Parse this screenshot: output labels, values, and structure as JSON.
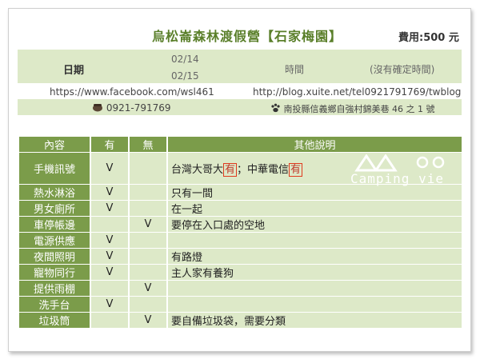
{
  "header": {
    "title": "烏松崙森林渡假營【石家梅園】",
    "fee": "費用:500 元"
  },
  "info": {
    "date_label": "日期",
    "date1": "02/14",
    "date2": "02/15",
    "time_label": "時間",
    "time_value": "(沒有確定時間)",
    "facebook": "https://www.facebook.com/wsl461",
    "blog": "http://blog.xuite.net/tel0921791769/twblog",
    "phone": "0921-791769",
    "address": "南投縣信義鄉自強村錦美巷 46 之 1 號"
  },
  "table": {
    "headers": [
      "內容",
      "有",
      "無",
      "其他說明"
    ],
    "rows": [
      {
        "item": "手機訊號",
        "yes": "V",
        "no": "",
        "note": "",
        "tall": true
      },
      {
        "item": "熱水淋浴",
        "yes": "V",
        "no": "",
        "note": "只有一間"
      },
      {
        "item": "男女廁所",
        "yes": "V",
        "no": "",
        "note": "在一起"
      },
      {
        "item": "車停帳邊",
        "yes": "",
        "no": "V",
        "note": "要停在入口處的空地"
      },
      {
        "item": "電源供應",
        "yes": "V",
        "no": "",
        "note": ""
      },
      {
        "item": "夜間照明",
        "yes": "V",
        "no": "",
        "note": "有路燈"
      },
      {
        "item": "寵物同行",
        "yes": "V",
        "no": "",
        "note": "主人家有養狗"
      },
      {
        "item": "提供雨棚",
        "yes": "",
        "no": "V",
        "note": ""
      },
      {
        "item": "洗手台",
        "yes": "V",
        "no": "",
        "note": ""
      },
      {
        "item": "垃圾筒",
        "yes": "",
        "no": "V",
        "note": "要自備垃圾袋，需要分類"
      }
    ],
    "signal_note": {
      "part1": "台灣大哥大",
      "mark1": "有",
      "sep": "；中華電信",
      "mark2": "有"
    }
  },
  "logo": {
    "text": "Camping vie"
  },
  "colors": {
    "green_dark": "#7b9c4a",
    "green_light": "#dde9c8",
    "title_green": "#5a7f2a",
    "highlight": "#e03a1e"
  }
}
